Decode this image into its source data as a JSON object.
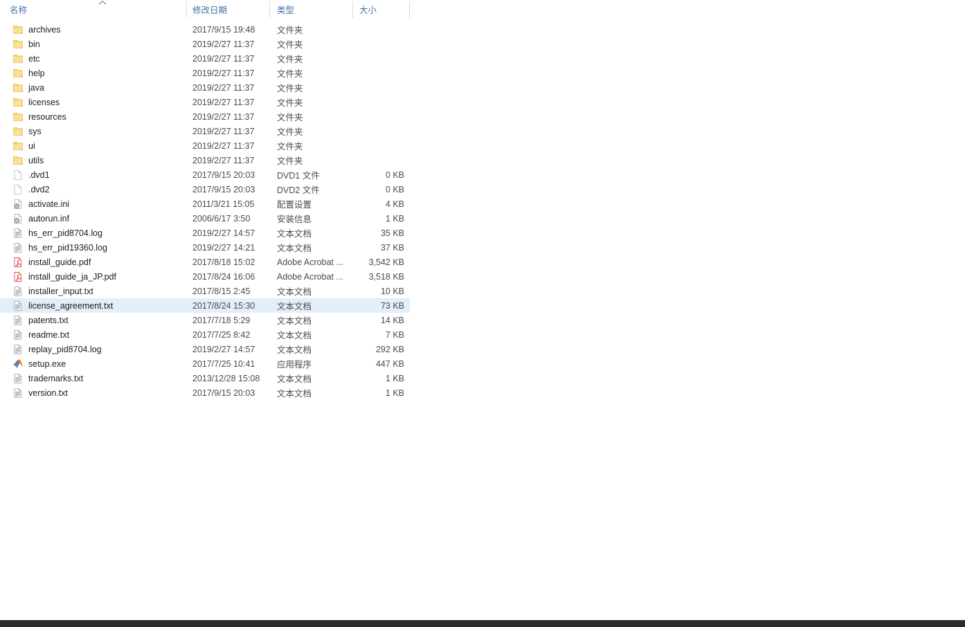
{
  "window": {
    "kind": "file-explorer-details-view"
  },
  "columns": {
    "name": "名称",
    "date_modified": "修改日期",
    "type": "类型",
    "size": "大小",
    "sort_column": "名称",
    "sort_direction": "ascending",
    "sort_icon": "chevron-up-icon",
    "header_color": "#4472a8"
  },
  "selection": {
    "selected_file": "license_agreement.txt",
    "highlight_color": "#e2effa"
  },
  "theme": {
    "background": "#ffffff",
    "divider": "#dadada",
    "text": "#1c1c1c",
    "muted_text": "#4a4a4a",
    "taskbar": "#2e2b2c",
    "folder_icon": "#f7d57f",
    "pdf_icon": "#e03a33"
  },
  "rows": [
    {
      "name": "archives",
      "date": "2017/9/15 19:48",
      "type": "文件夹",
      "size": "",
      "icon": "folder-icon",
      "selected": false
    },
    {
      "name": "bin",
      "date": "2019/2/27 11:37",
      "type": "文件夹",
      "size": "",
      "icon": "folder-icon",
      "selected": false
    },
    {
      "name": "etc",
      "date": "2019/2/27 11:37",
      "type": "文件夹",
      "size": "",
      "icon": "folder-icon",
      "selected": false
    },
    {
      "name": "help",
      "date": "2019/2/27 11:37",
      "type": "文件夹",
      "size": "",
      "icon": "folder-icon",
      "selected": false
    },
    {
      "name": "java",
      "date": "2019/2/27 11:37",
      "type": "文件夹",
      "size": "",
      "icon": "folder-icon",
      "selected": false
    },
    {
      "name": "licenses",
      "date": "2019/2/27 11:37",
      "type": "文件夹",
      "size": "",
      "icon": "folder-icon",
      "selected": false
    },
    {
      "name": "resources",
      "date": "2019/2/27 11:37",
      "type": "文件夹",
      "size": "",
      "icon": "folder-icon",
      "selected": false
    },
    {
      "name": "sys",
      "date": "2019/2/27 11:37",
      "type": "文件夹",
      "size": "",
      "icon": "folder-icon",
      "selected": false
    },
    {
      "name": "ui",
      "date": "2019/2/27 11:37",
      "type": "文件夹",
      "size": "",
      "icon": "folder-icon",
      "selected": false
    },
    {
      "name": "utils",
      "date": "2019/2/27 11:37",
      "type": "文件夹",
      "size": "",
      "icon": "folder-icon",
      "selected": false
    },
    {
      "name": ".dvd1",
      "date": "2017/9/15 20:03",
      "type": "DVD1 文件",
      "size": "0 KB",
      "icon": "blank-file-icon",
      "selected": false
    },
    {
      "name": ".dvd2",
      "date": "2017/9/15 20:03",
      "type": "DVD2 文件",
      "size": "0 KB",
      "icon": "blank-file-icon",
      "selected": false
    },
    {
      "name": "activate.ini",
      "date": "2011/3/21 15:05",
      "type": "配置设置",
      "size": "4 KB",
      "icon": "config-file-icon",
      "selected": false
    },
    {
      "name": "autorun.inf",
      "date": "2006/6/17 3:50",
      "type": "安装信息",
      "size": "1 KB",
      "icon": "config-file-icon",
      "selected": false
    },
    {
      "name": "hs_err_pid8704.log",
      "date": "2019/2/27 14:57",
      "type": "文本文档",
      "size": "35 KB",
      "icon": "text-file-icon",
      "selected": false
    },
    {
      "name": "hs_err_pid19360.log",
      "date": "2019/2/27 14:21",
      "type": "文本文档",
      "size": "37 KB",
      "icon": "text-file-icon",
      "selected": false
    },
    {
      "name": "install_guide.pdf",
      "date": "2017/8/18 15:02",
      "type": "Adobe Acrobat ...",
      "size": "3,542 KB",
      "icon": "pdf-file-icon",
      "selected": false
    },
    {
      "name": "install_guide_ja_JP.pdf",
      "date": "2017/8/24 16:06",
      "type": "Adobe Acrobat ...",
      "size": "3,518 KB",
      "icon": "pdf-file-icon",
      "selected": false
    },
    {
      "name": "installer_input.txt",
      "date": "2017/8/15 2:45",
      "type": "文本文档",
      "size": "10 KB",
      "icon": "text-file-icon",
      "selected": false
    },
    {
      "name": "license_agreement.txt",
      "date": "2017/8/24 15:30",
      "type": "文本文档",
      "size": "73 KB",
      "icon": "text-file-icon",
      "selected": true
    },
    {
      "name": "patents.txt",
      "date": "2017/7/18 5:29",
      "type": "文本文档",
      "size": "14 KB",
      "icon": "text-file-icon",
      "selected": false
    },
    {
      "name": "readme.txt",
      "date": "2017/7/25 8:42",
      "type": "文本文档",
      "size": "7 KB",
      "icon": "text-file-icon",
      "selected": false
    },
    {
      "name": "replay_pid8704.log",
      "date": "2019/2/27 14:57",
      "type": "文本文档",
      "size": "292 KB",
      "icon": "text-file-icon",
      "selected": false
    },
    {
      "name": "setup.exe",
      "date": "2017/7/25 10:41",
      "type": "应用程序",
      "size": "447 KB",
      "icon": "matlab-app-icon",
      "selected": false
    },
    {
      "name": "trademarks.txt",
      "date": "2013/12/28 15:08",
      "type": "文本文档",
      "size": "1 KB",
      "icon": "text-file-icon",
      "selected": false
    },
    {
      "name": "version.txt",
      "date": "2017/9/15 20:03",
      "type": "文本文档",
      "size": "1 KB",
      "icon": "text-file-icon",
      "selected": false
    }
  ]
}
